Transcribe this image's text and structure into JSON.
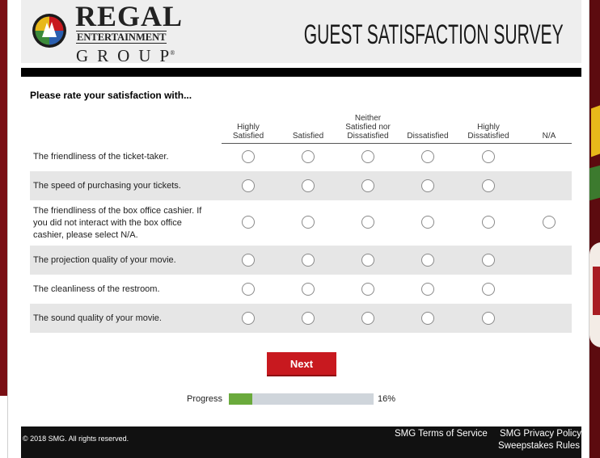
{
  "brand": {
    "name_line1": "REGAL",
    "name_line2": "ENTERTAINMENT",
    "name_line3": "GROUP",
    "registered_mark": "®",
    "survey_title": "GUEST SATISFACTION SURVEY"
  },
  "question": {
    "prompt": "Please rate your satisfaction with..."
  },
  "columns": [
    {
      "line1": "Highly",
      "line2": "Satisfied"
    },
    {
      "line1": "",
      "line2": "Satisfied"
    },
    {
      "line1": "Neither",
      "line2": "Satisfied nor",
      "line3": "Dissatisfied"
    },
    {
      "line1": "",
      "line2": "Dissatisfied"
    },
    {
      "line1": "Highly",
      "line2": "Dissatisfied"
    },
    {
      "line1": "",
      "line2": "N/A"
    }
  ],
  "rows": [
    {
      "label": "The friendliness of the ticket-taker.",
      "has_na": false
    },
    {
      "label": "The speed of purchasing your tickets.",
      "has_na": false
    },
    {
      "label": "The friendliness of the box office cashier. If you did not interact with the box office cashier, please select N/A.",
      "has_na": true
    },
    {
      "label": "The projection quality of your movie.",
      "has_na": false
    },
    {
      "label": "The cleanliness of the restroom.",
      "has_na": false
    },
    {
      "label": "The sound quality of your movie.",
      "has_na": false
    }
  ],
  "next_button": "Next",
  "progress": {
    "label": "Progress",
    "percent_text": "16%",
    "value": 16
  },
  "footer": {
    "copyright": "© 2018 SMG. All rights reserved.",
    "terms": "SMG Terms of Service",
    "privacy": "SMG Privacy Policy",
    "sweepstakes": "Sweepstakes Rules"
  },
  "colors": {
    "accent_red": "#c8191f",
    "progress_fill": "#6aaa3c",
    "progress_track": "#cfd5db",
    "row_shade": "#e6e6e6",
    "footer_bg": "#111111"
  }
}
